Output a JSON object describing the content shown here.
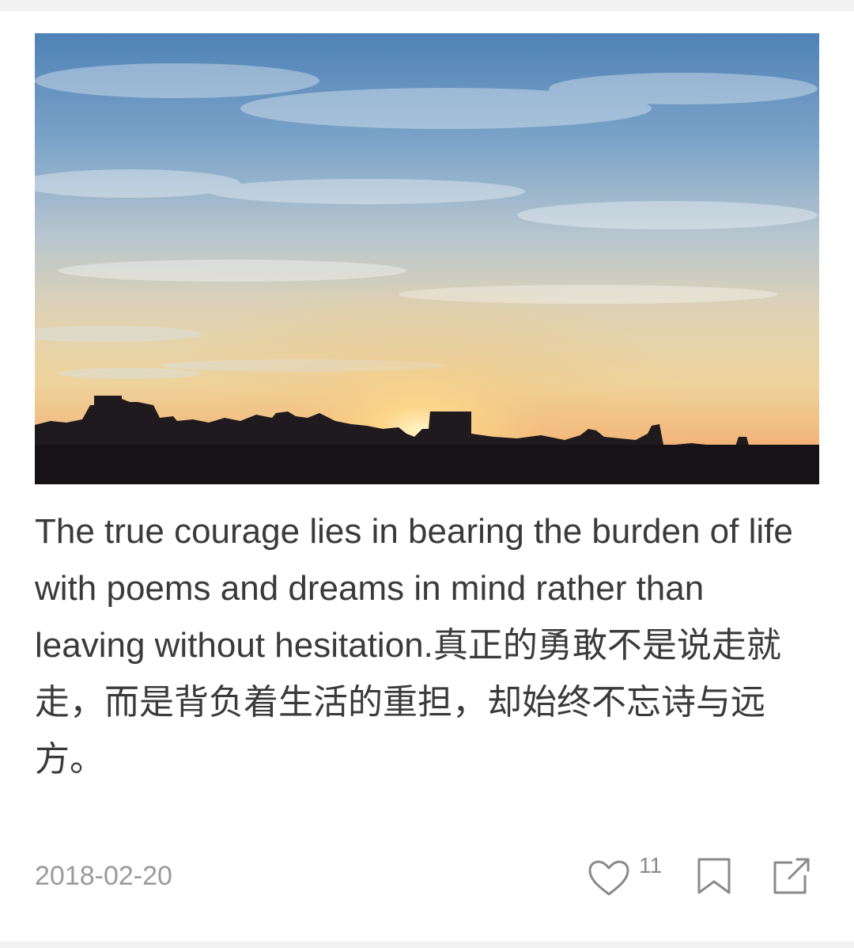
{
  "post": {
    "quote": "The true courage lies in bearing the burden of life with poems and dreams in mind rather than leaving without hesitation.真正的勇敢不是说走就走，而是背负着生活的重担，却始终不忘诗与远方。",
    "date": "2018-02-20"
  },
  "actions": {
    "like_count": "11",
    "like_icon": "heart-outline-icon",
    "bookmark_icon": "bookmark-icon",
    "share_icon": "share-icon"
  },
  "colors": {
    "text": "#3a3a3a",
    "muted": "#9a9a9a",
    "icon": "#8a8a8a",
    "background": "#ffffff"
  }
}
